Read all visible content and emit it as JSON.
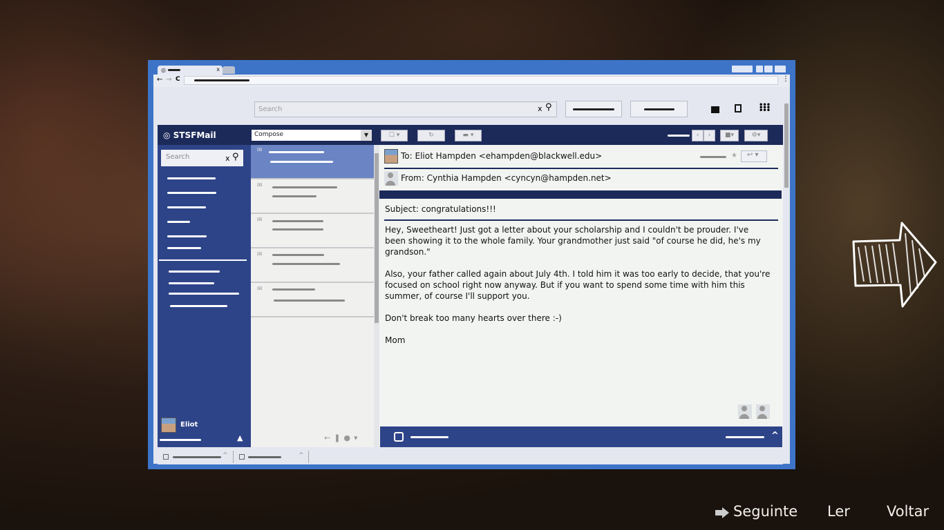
{
  "browser": {
    "search_placeholder": "Search",
    "star": "★",
    "menu": "⋮"
  },
  "app": {
    "name": "STSFMail",
    "compose_label": "Compose",
    "sidebar_search_placeholder": "Search",
    "user_name": "Eliot"
  },
  "email": {
    "to": "To: Eliot Hampden <ehampden@blackwell.edu>",
    "from": "From: Cynthia Hampden <cyncyn@hampden.net>",
    "subject": "Subject: congratulations!!!",
    "paragraphs": [
      "Hey, Sweetheart! Just got a letter about your scholarship and I couldn't be prouder. I've been showing it to the whole family. Your grandmother just said \"of course he did, he's my grandson.\"",
      "Also, your father called again about July 4th. I told him it was too early to decide, that you're focused on school right now anyway. But if you want to spend some time with him this summer, of course I'll support you.",
      "Don't break too many hearts over there :-)",
      "Mom"
    ]
  },
  "game_prompts": {
    "next": "Seguinte",
    "read": "Ler",
    "back": "Voltar"
  },
  "colors": {
    "frame": "#3d74c8",
    "navbar": "#1c2a5a",
    "sidebar": "#2e4489",
    "selected_row": "#6a84c4"
  }
}
